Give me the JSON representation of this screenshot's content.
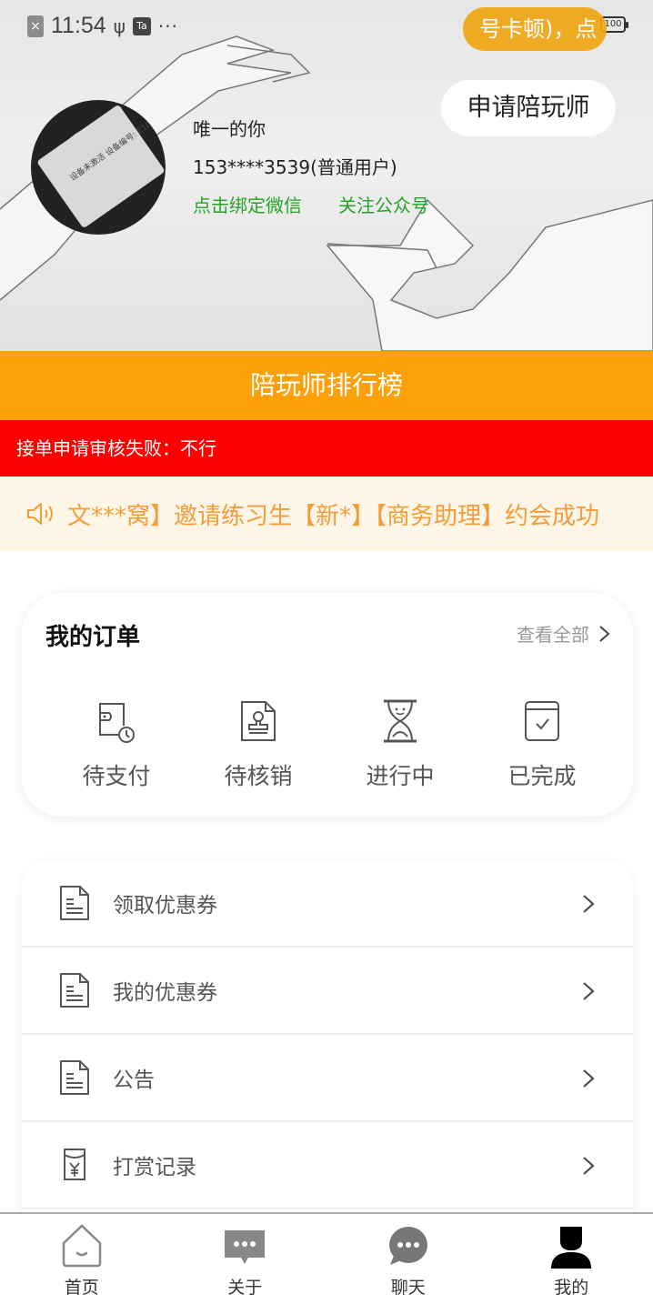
{
  "status_bar": {
    "time": "11:54",
    "left_icons": [
      "notification-x-icon",
      "usb-icon",
      "app-icon",
      "more-dots-icon"
    ],
    "battery": "100",
    "right_icons": [
      "wifi-icon",
      "battery-icon"
    ]
  },
  "toast": {
    "text": "号卡顿)，点"
  },
  "profile": {
    "apply_button": "申请陪玩师",
    "name": "唯一的你",
    "phone": "153****3539(普通用户)",
    "bind_wechat": "点击绑定微信",
    "follow_official": "关注公众号",
    "avatar_caption": "设备未激活 设备编号: E1D01BVPFF"
  },
  "banners": {
    "ranking": "陪玩师排行榜",
    "review_failed": "接单申请审核失败：不行",
    "marquee": "文***窝】邀请练习生【新*】【商务助理】约会成功"
  },
  "orders": {
    "title": "我的订单",
    "view_all": "查看全部",
    "items": [
      {
        "label": "待支付",
        "icon": "wallet-clock-icon"
      },
      {
        "label": "待核销",
        "icon": "stamp-document-icon"
      },
      {
        "label": "进行中",
        "icon": "hourglass-icon"
      },
      {
        "label": "已完成",
        "icon": "calendar-check-icon"
      }
    ]
  },
  "menu": [
    {
      "label": "领取优惠券",
      "icon": "document-icon"
    },
    {
      "label": "我的优惠券",
      "icon": "document-icon"
    },
    {
      "label": "公告",
      "icon": "document-icon"
    },
    {
      "label": "打赏记录",
      "icon": "red-envelope-yen-icon"
    }
  ],
  "tabbar": [
    {
      "label": "首页",
      "icon": "home-icon",
      "active": false
    },
    {
      "label": "关于",
      "icon": "message-box-icon",
      "active": false
    },
    {
      "label": "聊天",
      "icon": "chat-bubble-icon",
      "active": false
    },
    {
      "label": "我的",
      "icon": "person-icon",
      "active": true
    }
  ],
  "colors": {
    "ranking_bar": "#fda00a",
    "review_failed_bar": "#fe0000",
    "notice_bg": "#fdf6e6",
    "notice_text": "#f39c3c",
    "link_green": "#27a427",
    "toast": "#f0a514"
  }
}
